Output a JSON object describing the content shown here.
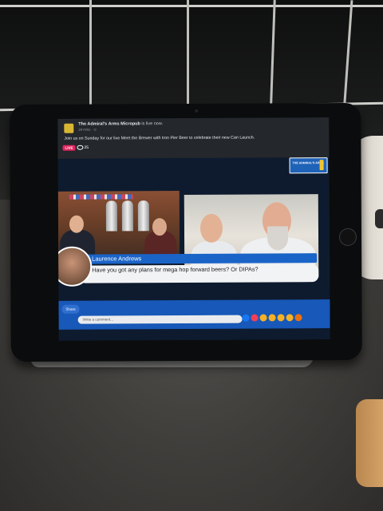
{
  "post": {
    "page_name": "The Admiral's Arms Micropub",
    "status": "is live now.",
    "time": "24 mins · ⊙",
    "text": "Join us on Sunday for our live Meet the Brewer with Iron Pier Beer to celebrate their new Can Launch."
  },
  "live": {
    "badge": "LIVE",
    "viewers": "25"
  },
  "overlay": {
    "logo_text": "THE ADMIRAL'S ARMS"
  },
  "comment": {
    "author": "Laurence Andrews",
    "text": "Have you got any plans for mega hop forward beers? Or DIPAs?"
  },
  "controls": {
    "share_label": "Share",
    "comment_placeholder": "Write a comment..."
  },
  "reactions": [
    {
      "name": "like-reaction-icon",
      "color": "#1877f2"
    },
    {
      "name": "love-reaction-icon",
      "color": "#f33e58"
    },
    {
      "name": "care-reaction-icon",
      "color": "#f7b125"
    },
    {
      "name": "haha-reaction-icon",
      "color": "#f7b125"
    },
    {
      "name": "wow-reaction-icon",
      "color": "#f7b125"
    },
    {
      "name": "sad-reaction-icon",
      "color": "#f7b125"
    },
    {
      "name": "angry-reaction-icon",
      "color": "#e9710f"
    }
  ]
}
